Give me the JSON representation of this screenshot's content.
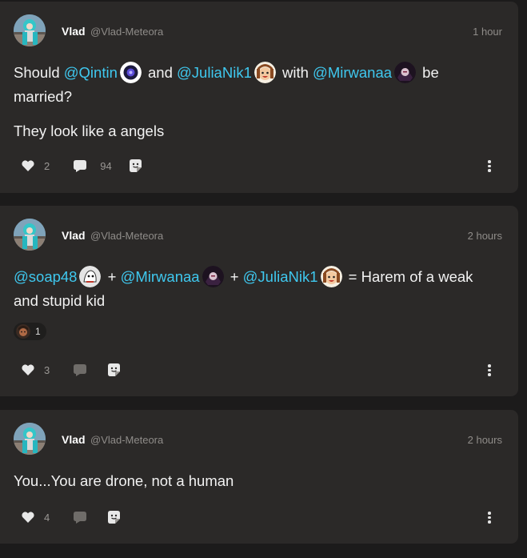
{
  "posts": [
    {
      "author": {
        "name": "Vlad",
        "handle": "@Vlad-Meteora"
      },
      "timestamp": "1 hour",
      "line1": {
        "t0": "Should ",
        "m0": "@Qintin",
        "t1": " and ",
        "m1": "@JuliaNik1",
        "t2": " with ",
        "m2": "@Mirwanaa",
        "t3": " be"
      },
      "line2": "married?",
      "line3": "They look like a angels",
      "likes": "2",
      "comments": "94"
    },
    {
      "author": {
        "name": "Vlad",
        "handle": "@Vlad-Meteora"
      },
      "timestamp": "2 hours",
      "line1": {
        "m0": "@soap48",
        "t1": " + ",
        "m1": "@Mirwanaa",
        "t2": " + ",
        "m2": "@JuliaNik1",
        "t3": " = Harem of a weak"
      },
      "line2": "and stupid kid",
      "reaction_count": "1",
      "likes": "3"
    },
    {
      "author": {
        "name": "Vlad",
        "handle": "@Vlad-Meteora"
      },
      "timestamp": "2 hours",
      "line1": "You...You are drone, not a human",
      "likes": "4"
    }
  ],
  "icons": {
    "like": "heart-icon",
    "comment": "comment-bubble-icon",
    "share": "share-sticker-icon",
    "more": "more-vertical-icon"
  },
  "colors": {
    "background": "#1c1b1b",
    "card": "#2b2928",
    "mention": "#3fc8ef",
    "muted": "#8f8c89"
  }
}
